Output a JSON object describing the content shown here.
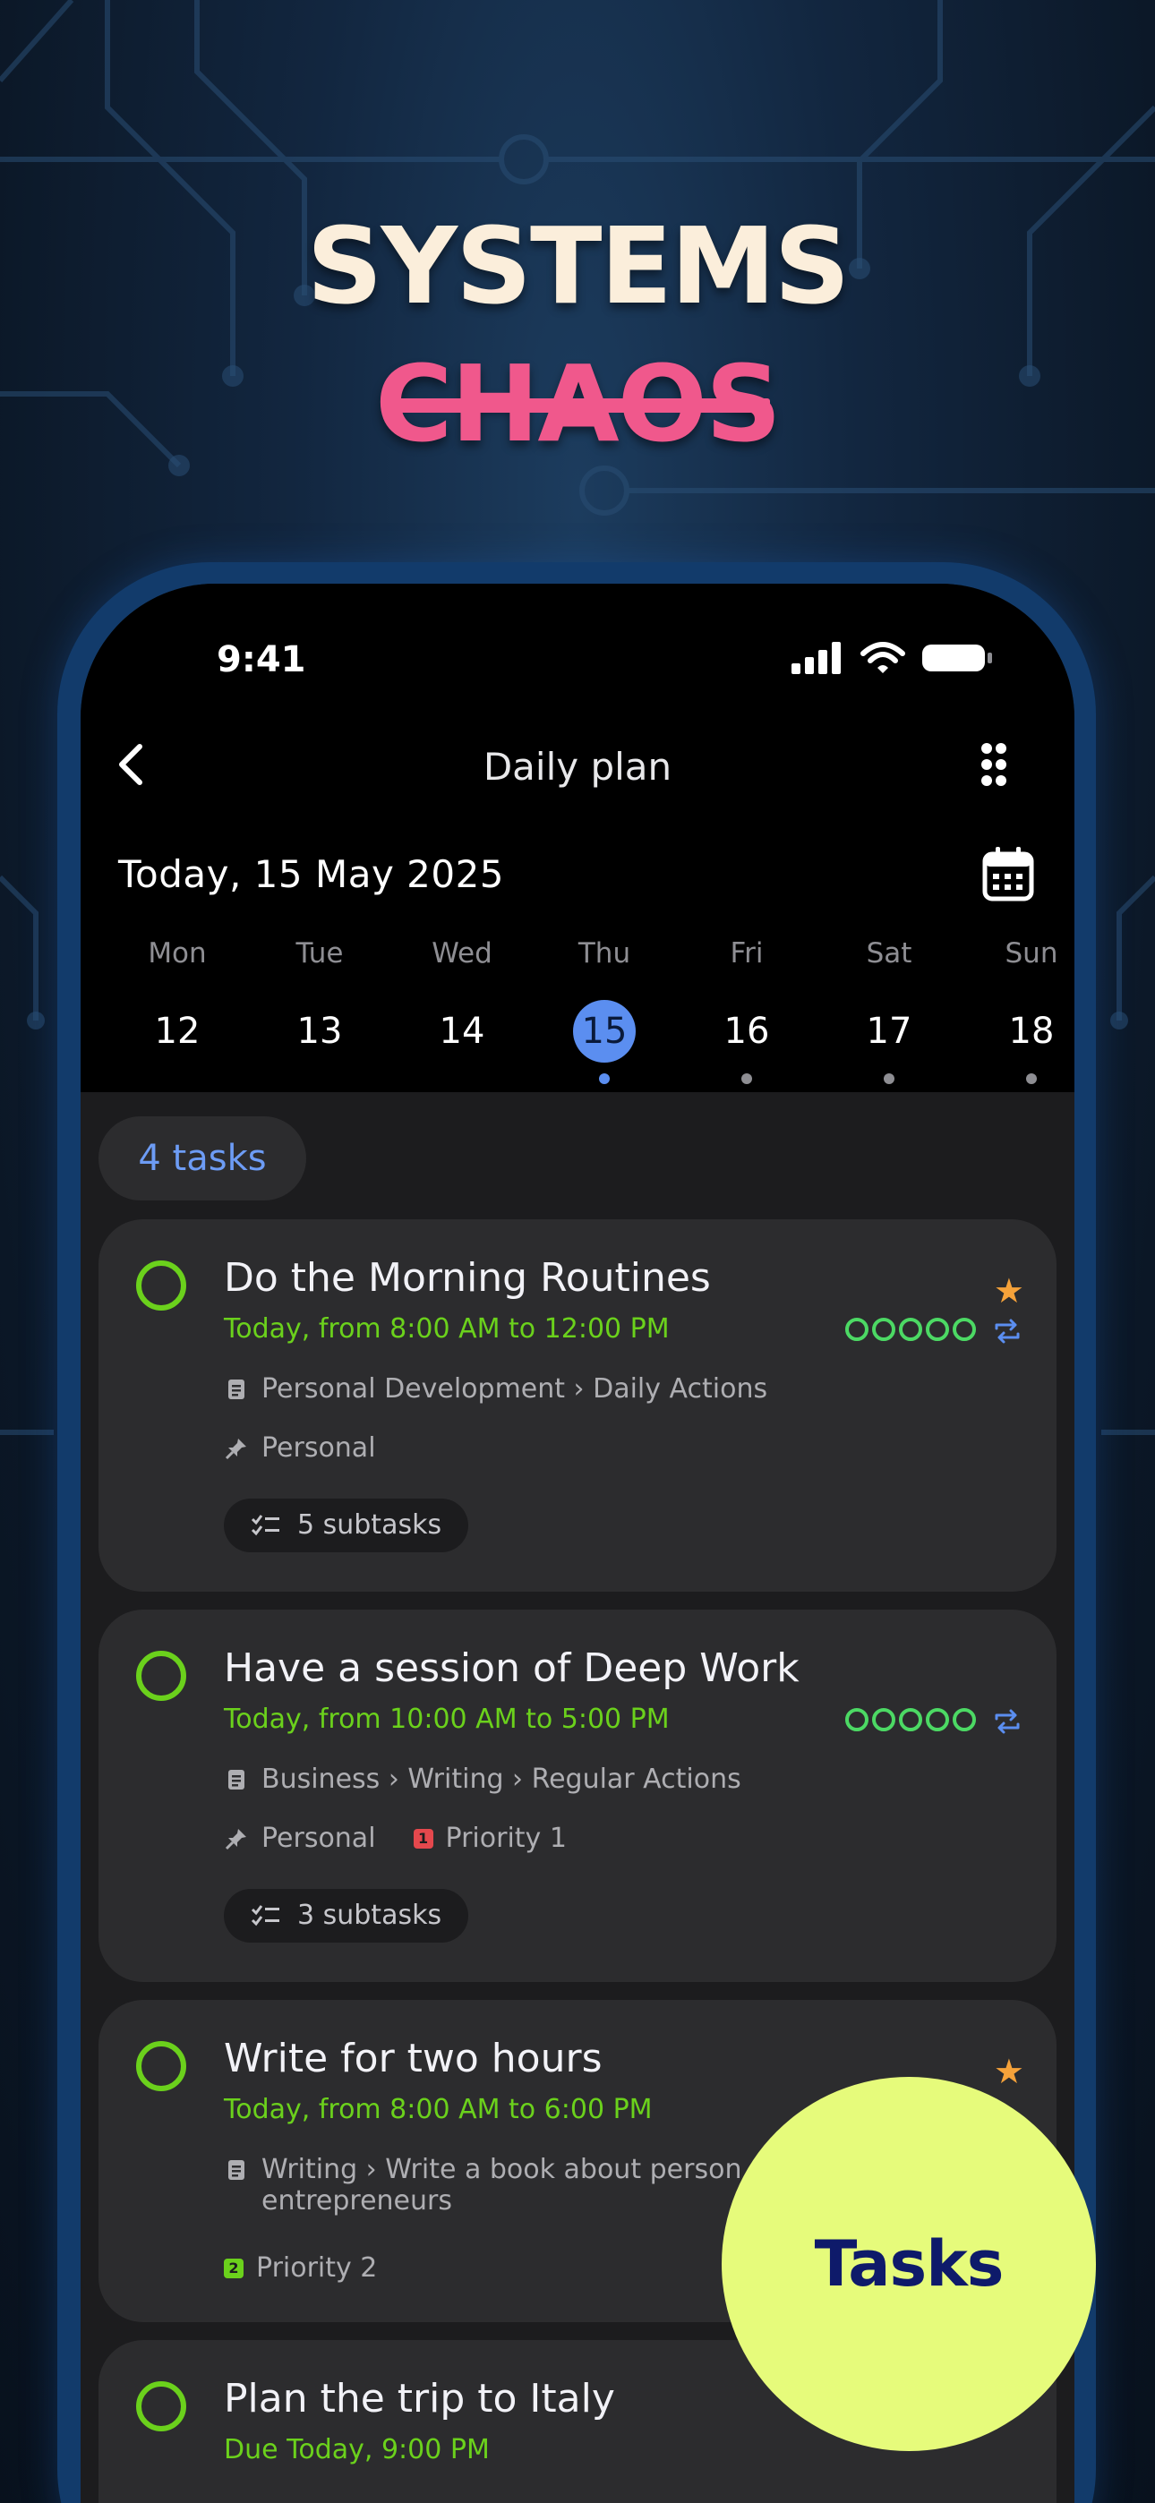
{
  "headline": {
    "line1": "SYSTEMS",
    "line2": "CHAOS"
  },
  "status_bar": {
    "time": "9:41"
  },
  "nav": {
    "title": "Daily plan"
  },
  "date_header": "Today, 15 May 2025",
  "week": [
    {
      "name": "Mon",
      "num": "12",
      "selected": false,
      "dot": false
    },
    {
      "name": "Tue",
      "num": "13",
      "selected": false,
      "dot": false
    },
    {
      "name": "Wed",
      "num": "14",
      "selected": false,
      "dot": false
    },
    {
      "name": "Thu",
      "num": "15",
      "selected": true,
      "dot": true
    },
    {
      "name": "Fri",
      "num": "16",
      "selected": false,
      "dot": true
    },
    {
      "name": "Sat",
      "num": "17",
      "selected": false,
      "dot": true
    },
    {
      "name": "Sun",
      "num": "18",
      "selected": false,
      "dot": true
    }
  ],
  "tasks_count": "4 tasks",
  "tasks": [
    {
      "title": "Do the Morning Routines",
      "time": "Today, from 8:00 AM to 12:00 PM",
      "path": "Personal Development › Daily Actions",
      "tag": "Personal",
      "subtasks": "5 subtasks"
    },
    {
      "title": "Have a session of Deep Work",
      "time": "Today, from 10:00 AM to 5:00 PM",
      "path": "Business › Writing › Regular Actions",
      "tag": "Personal",
      "priority": "Priority 1",
      "subtasks": "3 subtasks"
    },
    {
      "title": "Write for two hours",
      "time": "Today, from 8:00 AM to 6:00 PM",
      "path_line1": "Writing › Write a book about person",
      "path_line2": "entrepreneurs",
      "priority": "Priority 2"
    },
    {
      "title": "Plan the trip to Italy",
      "time": "Due Today, 9:00 PM"
    }
  ],
  "fab": {
    "label": "Tasks"
  },
  "colors": {
    "accent_green": "#6bd11c",
    "accent_blue": "#5b8ef0",
    "fab": "#e6fb7b",
    "chaos_pink": "#f0588c"
  }
}
